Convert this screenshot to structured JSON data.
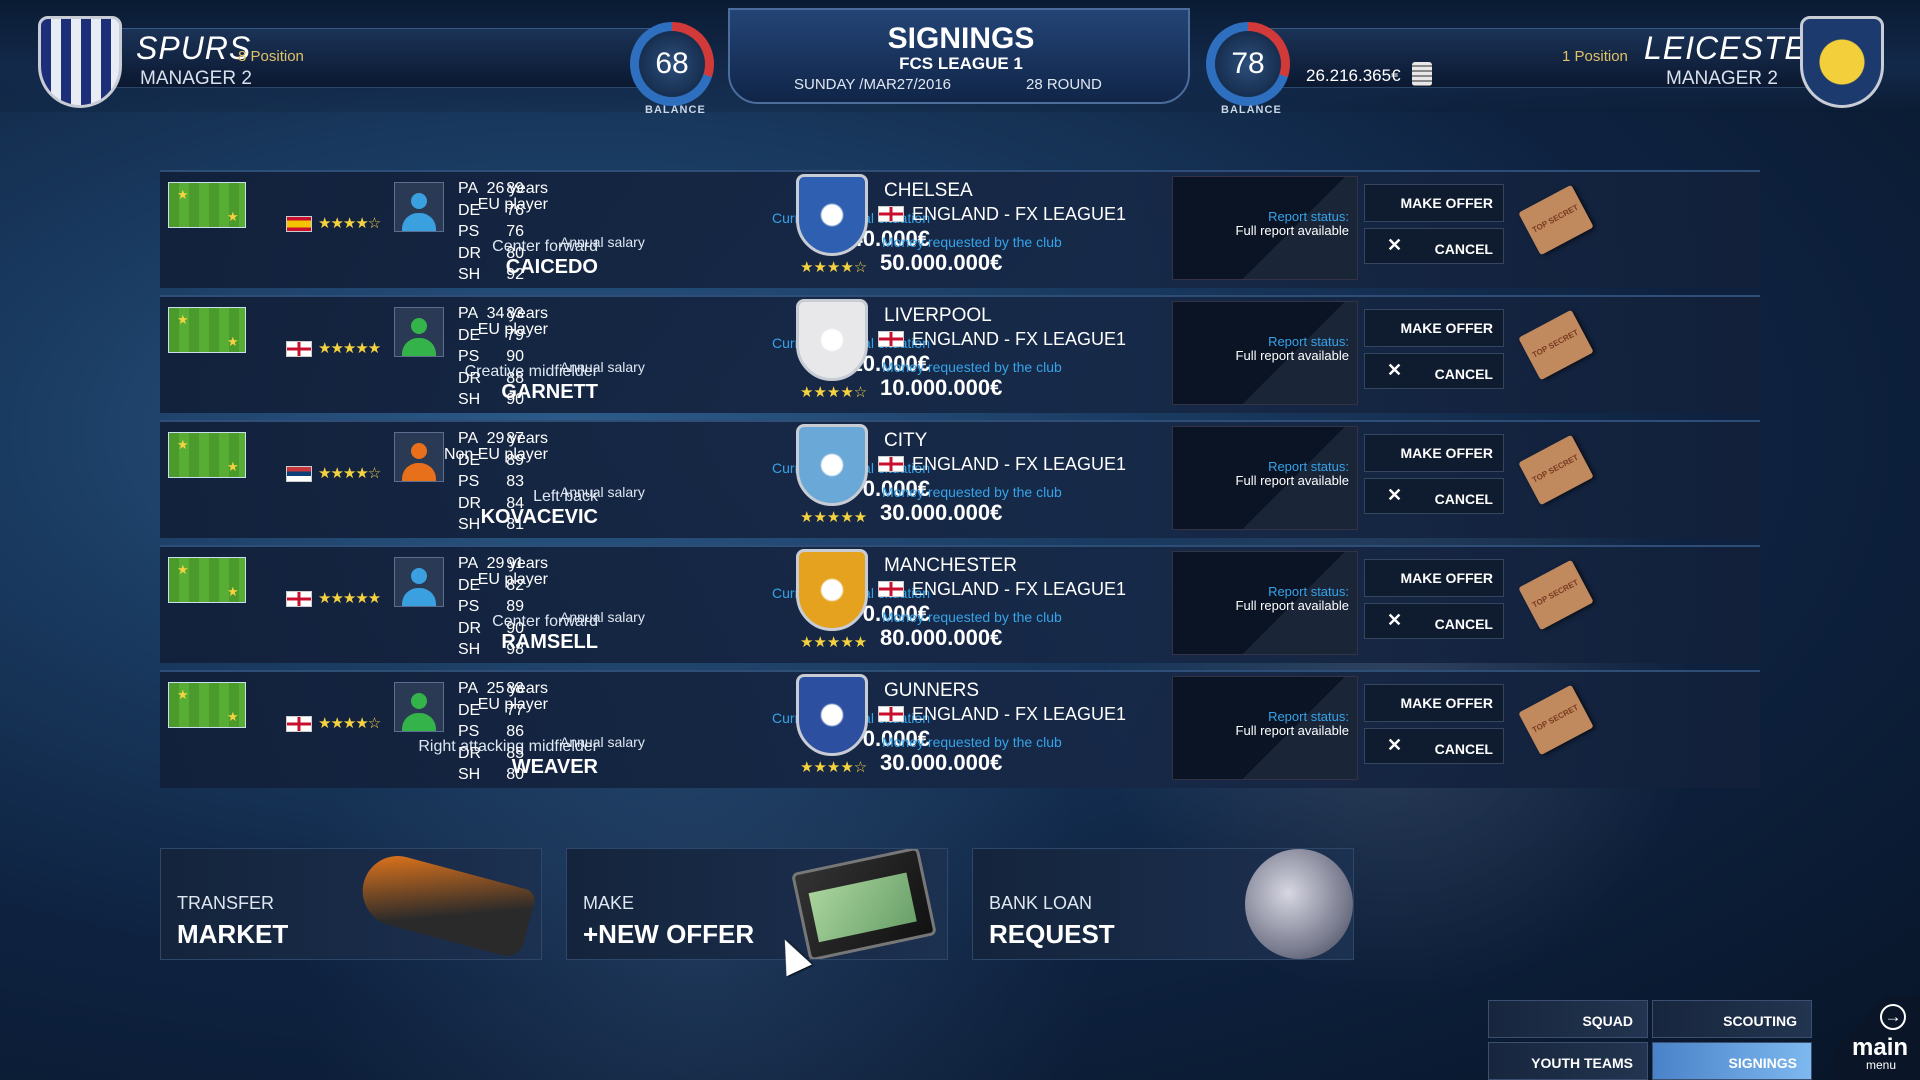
{
  "header": {
    "left_team": "SPURS",
    "left_position": "8 Position",
    "left_manager": "MANAGER 2",
    "left_balance": "68",
    "balance_label": "BALANCE",
    "title": "SIGNINGS",
    "league": "FCS LEAGUE 1",
    "date": "SUNDAY /MAR27/2016",
    "round": "28 ROUND",
    "right_balance": "78",
    "money": "26.216.365€",
    "right_position": "1 Position",
    "right_team": "LEICESTER",
    "right_manager": "MANAGER 2"
  },
  "labels": {
    "cfs": "Current financial situation",
    "annual_salary": "Annual salary",
    "money_requested": "Money requested by the club",
    "report_status": "Report status:",
    "make_offer": "MAKE OFFER",
    "cancel": "CANCEL",
    "top_secret": "TOP SECRET"
  },
  "rows": [
    {
      "age": "26 years",
      "eu": "EU player",
      "flag": "es",
      "stars": "★★★★☆",
      "role": "Center forward",
      "name": "CAICEDO",
      "stats": [
        [
          "PA",
          "89"
        ],
        [
          "DE",
          "76"
        ],
        [
          "PS",
          "76"
        ],
        [
          "DR",
          "80"
        ],
        [
          "SH",
          "92"
        ]
      ],
      "salary": "3.440.000€",
      "club": "CHELSEA",
      "club_league": "ENGLAND - FX LEAGUE1",
      "club_stars": "★★★★☆",
      "requested": "50.000.000€",
      "report": "Full report available",
      "avatar": "#3aa0e0",
      "crest": "#2f5fb0"
    },
    {
      "age": "34 years",
      "eu": "EU player",
      "flag": "en",
      "stars": "★★★★★",
      "role": "Creative midfielder",
      "name": "GARNETT",
      "stats": [
        [
          "PA",
          "83"
        ],
        [
          "DE",
          "79"
        ],
        [
          "PS",
          "90"
        ],
        [
          "DR",
          "88"
        ],
        [
          "SH",
          "90"
        ]
      ],
      "salary": "2.510.000€",
      "club": "LIVERPOOL",
      "club_league": "ENGLAND - FX LEAGUE1",
      "club_stars": "★★★★☆",
      "requested": "10.000.000€",
      "report": "Full report available",
      "avatar": "#34b34a",
      "crest": "#e8e8ea"
    },
    {
      "age": "29 years",
      "eu": "Non EU player",
      "flag": "rs",
      "stars": "★★★★☆",
      "role": "Left back",
      "name": "KOVACEVIC",
      "stats": [
        [
          "PA",
          "87"
        ],
        [
          "DE",
          "89"
        ],
        [
          "PS",
          "83"
        ],
        [
          "DR",
          "84"
        ],
        [
          "SH",
          "81"
        ]
      ],
      "salary": "2.170.000€",
      "club": "CITY",
      "club_league": "ENGLAND - FX LEAGUE1",
      "club_stars": "★★★★★",
      "requested": "30.000.000€",
      "report": "Full report available",
      "avatar": "#e8701a",
      "crest": "#6aa8d8"
    },
    {
      "age": "29 years",
      "eu": "EU player",
      "flag": "en",
      "stars": "★★★★★",
      "role": "Center forward",
      "name": "RAMSELL",
      "stats": [
        [
          "PA",
          "91"
        ],
        [
          "DE",
          "82"
        ],
        [
          "PS",
          "89"
        ],
        [
          "DR",
          "90"
        ],
        [
          "SH",
          "98"
        ]
      ],
      "salary": "7.270.000€",
      "club": "MANCHESTER",
      "club_league": "ENGLAND - FX LEAGUE1",
      "club_stars": "★★★★★",
      "requested": "80.000.000€",
      "report": "Full report available",
      "avatar": "#3aa0e0",
      "crest": "#e5a21e"
    },
    {
      "age": "25 years",
      "eu": "EU player",
      "flag": "en",
      "stars": "★★★★☆",
      "role": "Right attacking midfielder",
      "name": "WEAVER",
      "stats": [
        [
          "PA",
          "88"
        ],
        [
          "DE",
          "77"
        ],
        [
          "PS",
          "86"
        ],
        [
          "DR",
          "85"
        ],
        [
          "SH",
          "80"
        ]
      ],
      "salary": "2.170.000€",
      "club": "GUNNERS",
      "club_league": "ENGLAND - FX LEAGUE1",
      "club_stars": "★★★★☆",
      "requested": "30.000.000€",
      "report": "Full report available",
      "avatar": "#34b34a",
      "crest": "#2c4fa0"
    }
  ],
  "bottom": {
    "transfer_l1": "TRANSFER",
    "transfer_l2": "MARKET",
    "offer_l1": "MAKE",
    "offer_l2": "+NEW OFFER",
    "loan_l1": "BANK LOAN",
    "loan_l2": "REQUEST"
  },
  "nav": {
    "squad": "SQUAD",
    "scouting": "SCOUTING",
    "youth": "YOUTH TEAMS",
    "signings": "SIGNINGS",
    "main1": "main",
    "main2": "menu"
  }
}
